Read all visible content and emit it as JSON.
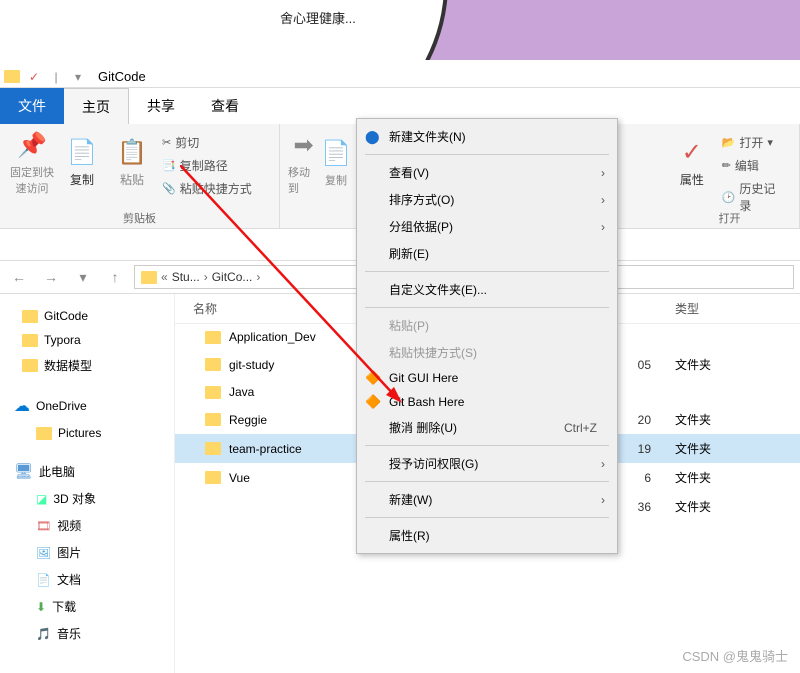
{
  "bg_text": "舍心理健康...",
  "window_title": "GitCode",
  "tabs": {
    "file": "文件",
    "home": "主页",
    "share": "共享",
    "view": "查看"
  },
  "ribbon": {
    "pin": "固定到快速访问",
    "copy": "复制",
    "paste": "粘贴",
    "cut": "剪切",
    "copy_path": "复制路径",
    "paste_shortcut": "粘贴快捷方式",
    "clipboard": "剪贴板",
    "move_to": "移动到",
    "copy_to": "复制",
    "properties": "属性",
    "open": "打开",
    "edit": "编辑",
    "history": "历史记录",
    "open_grp": "打开"
  },
  "breadcrumb": [
    "Stu...",
    "GitCo..."
  ],
  "tree": {
    "gitcode": "GitCode",
    "typora": "Typora",
    "datamodel": "数据模型",
    "onedrive": "OneDrive",
    "pictures": "Pictures",
    "thispc": "此电脑",
    "objects3d": "3D 对象",
    "video": "视频",
    "images": "图片",
    "docs": "文档",
    "downloads": "下载",
    "music": "音乐"
  },
  "list_head": {
    "name": "名称",
    "type": "类型"
  },
  "folders": [
    {
      "name": "Application_Dev",
      "date": "",
      "type": ""
    },
    {
      "name": "git-study",
      "date": "05",
      "type": "文件夹"
    },
    {
      "name": "Java",
      "date": "",
      "type": ""
    },
    {
      "name": "Reggie",
      "date": "20",
      "type": "文件夹"
    },
    {
      "name": "team-practice",
      "date": "19",
      "type": "文件夹",
      "selected": true
    },
    {
      "name": "Vue",
      "date": "6",
      "type": "文件夹"
    }
  ],
  "extra_rows": [
    {
      "date": "36",
      "type": "文件夹"
    }
  ],
  "context": {
    "new_folder": "新建文件夹(N)",
    "view": "查看(V)",
    "sort": "排序方式(O)",
    "group": "分组依据(P)",
    "refresh": "刷新(E)",
    "customize": "自定义文件夹(E)...",
    "paste": "粘贴(P)",
    "paste_shortcut": "粘贴快捷方式(S)",
    "git_gui": "Git GUI Here",
    "git_bash": "Git Bash Here",
    "undo_delete": "撤消 删除(U)",
    "undo_shortcut": "Ctrl+Z",
    "grant_access": "授予访问权限(G)",
    "new": "新建(W)",
    "props": "属性(R)"
  },
  "watermark": "CSDN @鬼鬼骑士",
  "colors": {
    "accent": "#1a6fcc",
    "folder": "#ffd766"
  }
}
